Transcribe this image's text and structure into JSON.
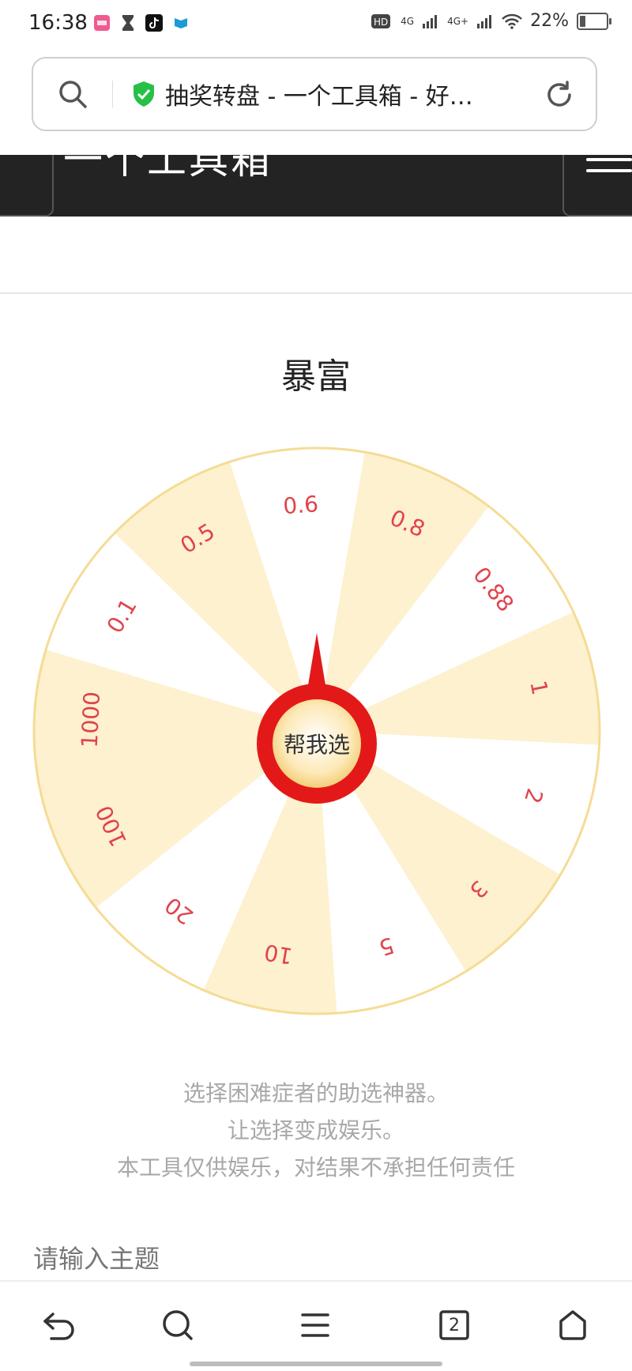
{
  "status_bar": {
    "time": "16:38",
    "network_labels": [
      "4G",
      "4G+"
    ],
    "battery": "22%",
    "battery_level": 0.22,
    "notification_icons": [
      "app-notification-icon",
      "hourglass-icon",
      "tiktok-icon",
      "flag-app-icon"
    ]
  },
  "address_bar": {
    "title": "抽奖转盘 - 一个工具箱 - 好…",
    "secure_icon": "shield-check-icon",
    "search_icon": "search-icon",
    "refresh_icon": "refresh-icon"
  },
  "site_header": {
    "title": "一个工具箱",
    "menu_icon": "hamburger-icon"
  },
  "wheel": {
    "title": "暴富",
    "button_label": "帮我选",
    "segments": [
      {
        "label": "1000"
      },
      {
        "label": "0.1"
      },
      {
        "label": "0.5"
      },
      {
        "label": "0.6"
      },
      {
        "label": "0.8"
      },
      {
        "label": "0.88"
      },
      {
        "label": "1"
      },
      {
        "label": "2"
      },
      {
        "label": "3"
      },
      {
        "label": "5"
      },
      {
        "label": "10"
      },
      {
        "label": "20"
      },
      {
        "label": "100"
      }
    ],
    "colors": {
      "segment_a": "#fdf1cf",
      "segment_b": "#ffffff",
      "label": "#e0434b",
      "rim": "#f5dc95",
      "pointer": "#e31919"
    }
  },
  "description": {
    "lines": [
      "选择困难症者的助选神器。",
      "让选择变成娱乐。",
      "本工具仅供娱乐，对结果不承担任何责任"
    ]
  },
  "topic_input": {
    "label": "请输入主题"
  },
  "bottom_nav": {
    "tab_count": "2",
    "items": [
      "back-icon",
      "search-icon",
      "menu-icon",
      "tabs-icon",
      "home-icon"
    ]
  }
}
